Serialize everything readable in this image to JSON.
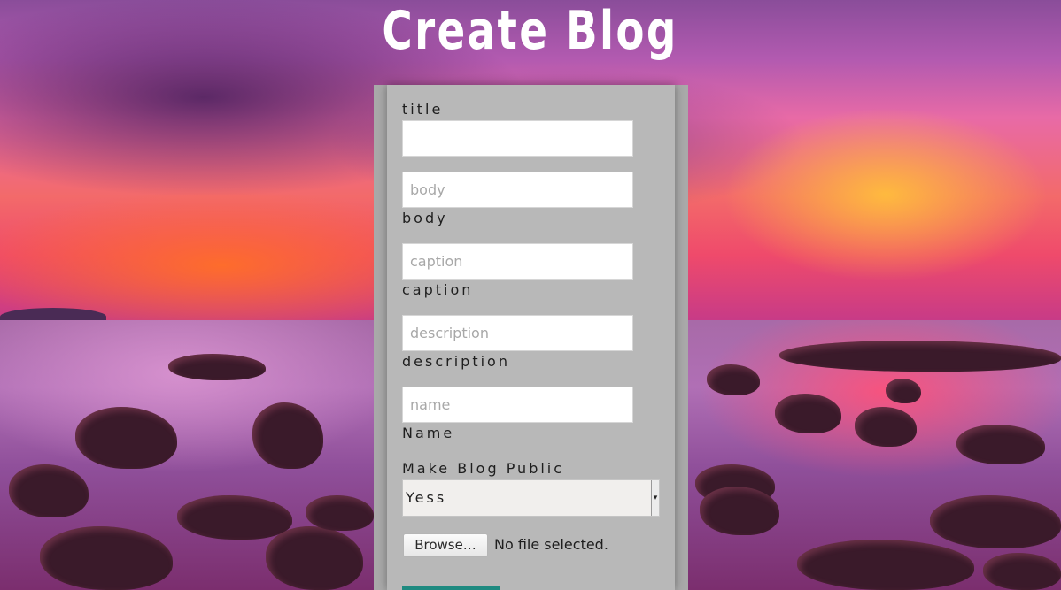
{
  "page": {
    "title": "Create Blog"
  },
  "form": {
    "fields": [
      {
        "label": "title",
        "placeholder": "",
        "value": ""
      },
      {
        "label": "body",
        "placeholder": "body",
        "value": ""
      },
      {
        "label": "caption",
        "placeholder": "caption",
        "value": ""
      },
      {
        "label": "description",
        "placeholder": "description",
        "value": ""
      },
      {
        "label": "Name",
        "placeholder": "name",
        "value": ""
      }
    ],
    "public_label": "Make Blog Public",
    "public_select": {
      "selected": "Yess",
      "arrow": "▾"
    },
    "file": {
      "button_label": "Browse…",
      "status": "No file selected."
    }
  },
  "colors": {
    "panel": "#b8b8b8",
    "submit_accent": "#1e8a80",
    "title": "#ffffff"
  },
  "icons": {
    "select_arrow": "chevron-down-icon"
  }
}
